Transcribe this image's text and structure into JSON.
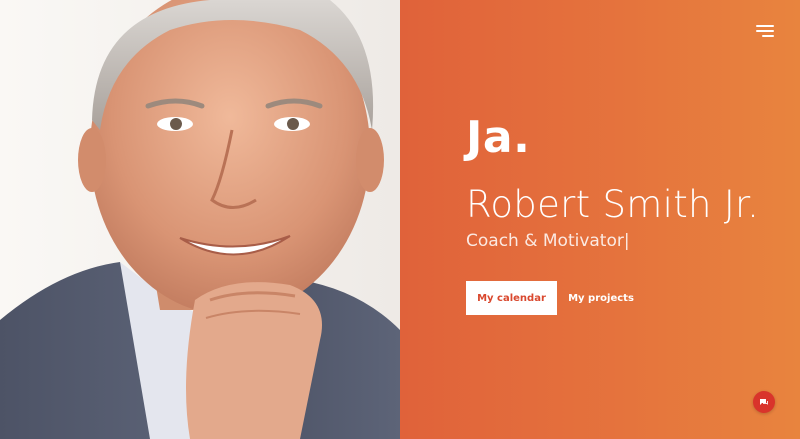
{
  "hero": {
    "logo": "Ja.",
    "name": "Robert Smith Jr.",
    "role": "Coach & Motivator|",
    "buttons": {
      "calendar": "My calendar",
      "projects": "My projects"
    }
  },
  "icons": {
    "menu": "hamburger-menu-icon",
    "chat": "chat-bubble-icon"
  },
  "colors": {
    "panel_start": "#e0623a",
    "panel_end": "#e8843e",
    "button_text": "#d9482e",
    "chat_button": "#d9342b"
  }
}
